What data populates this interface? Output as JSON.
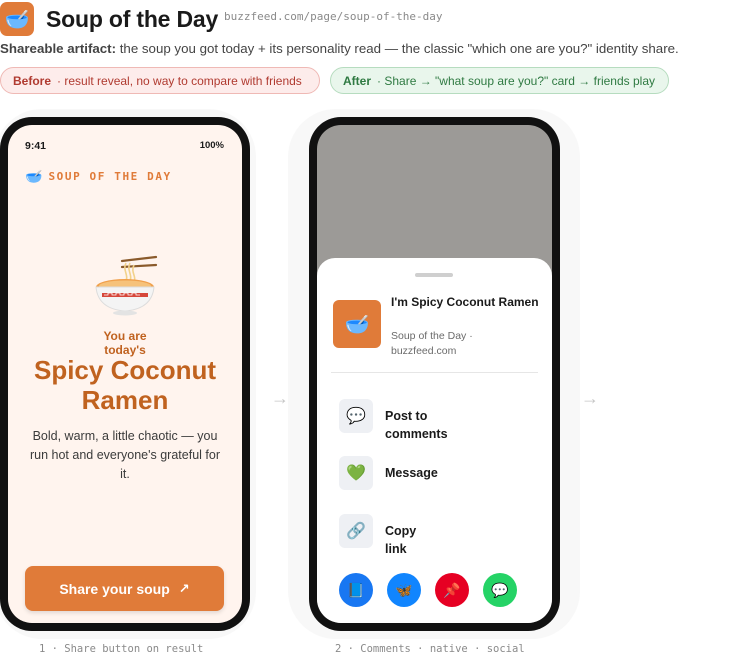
{
  "header": {
    "app_icon": "bowl-emoji",
    "title": "Soup of the Day",
    "url": "buzzfeed.com/page/soup-of-the-day"
  },
  "subtitle": {
    "label": "Shareable artifact:",
    "text": " the soup you got today + its personality read — the classic \"which one are you?\" identity share."
  },
  "pills": {
    "before_label": "Before",
    "before_text": "· result reveal, no way to compare with friends",
    "after_label": "After",
    "after_text": "· Share → \"what soup are you?\" card → friends play"
  },
  "colors": {
    "accent": "#e07b39",
    "accent_text": "#c0621f",
    "before_bg": "#fdeceb",
    "after_bg": "#e9f6ec"
  },
  "phone1": {
    "status_time": "9:41",
    "status_battery": "100%",
    "brand_icon": "🥣",
    "brand_label": "SOUP OF THE DAY",
    "intro": "You are today's",
    "result_title": "Spicy Coconut Ramen",
    "result_desc": "Bold, warm, a little chaotic — you run hot and everyone's grateful for it.",
    "share_button": "Share your soup",
    "share_arrow": "↗",
    "caption": "1 · Share button on result"
  },
  "phone2": {
    "share_thumb": "🥣",
    "share_title": "I'm Spicy Coconut Ramen",
    "share_meta": "Soup of the Day · buzzfeed.com",
    "actions": [
      {
        "icon": "💬",
        "label": "Post to comments"
      },
      {
        "icon": "💚",
        "label": "Message"
      },
      {
        "icon": "🔗",
        "label": "Copy link"
      }
    ],
    "apps": [
      {
        "icon": "📘",
        "color": "#1877f2"
      },
      {
        "icon": "🦋",
        "color": "#1185fe"
      },
      {
        "icon": "📌",
        "color": "#e60023"
      },
      {
        "icon": "💬",
        "color": "#25d366"
      }
    ],
    "caption": "2 · Comments · native · social"
  },
  "flow_arrow": "→"
}
